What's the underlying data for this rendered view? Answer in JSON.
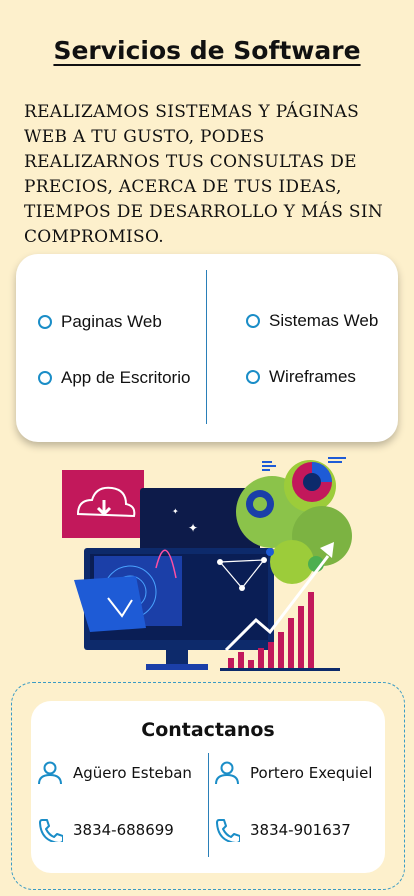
{
  "page": {
    "title": "Servicios de Software",
    "intro": "Realizamos sistemas y páginas web a tu gusto,  podes realizarnos tus consultas de precios, acerca de tus ideas, tiempos de desarrollo y más sin compromiso."
  },
  "services": {
    "items": [
      {
        "label": "Paginas Web",
        "icon": "circle-bullet-icon"
      },
      {
        "label": "App de Escritorio",
        "icon": "circle-bullet-icon"
      },
      {
        "label": "Sistemas Web",
        "icon": "circle-bullet-icon"
      },
      {
        "label": "Wireframes",
        "icon": "circle-bullet-icon"
      }
    ]
  },
  "illustration": {
    "icon": "software-development-illustration"
  },
  "contact": {
    "title": "Contactanos",
    "people": [
      {
        "name": "Agüero Esteban",
        "phone": "3834-688699"
      },
      {
        "name": "Portero Exequiel",
        "phone": "3834-901637"
      }
    ],
    "icons": {
      "person": "user-icon",
      "phone": "phone-icon"
    }
  },
  "colors": {
    "background": "#fdf0cc",
    "accent": "#1a8dc7",
    "card": "#ffffff"
  }
}
